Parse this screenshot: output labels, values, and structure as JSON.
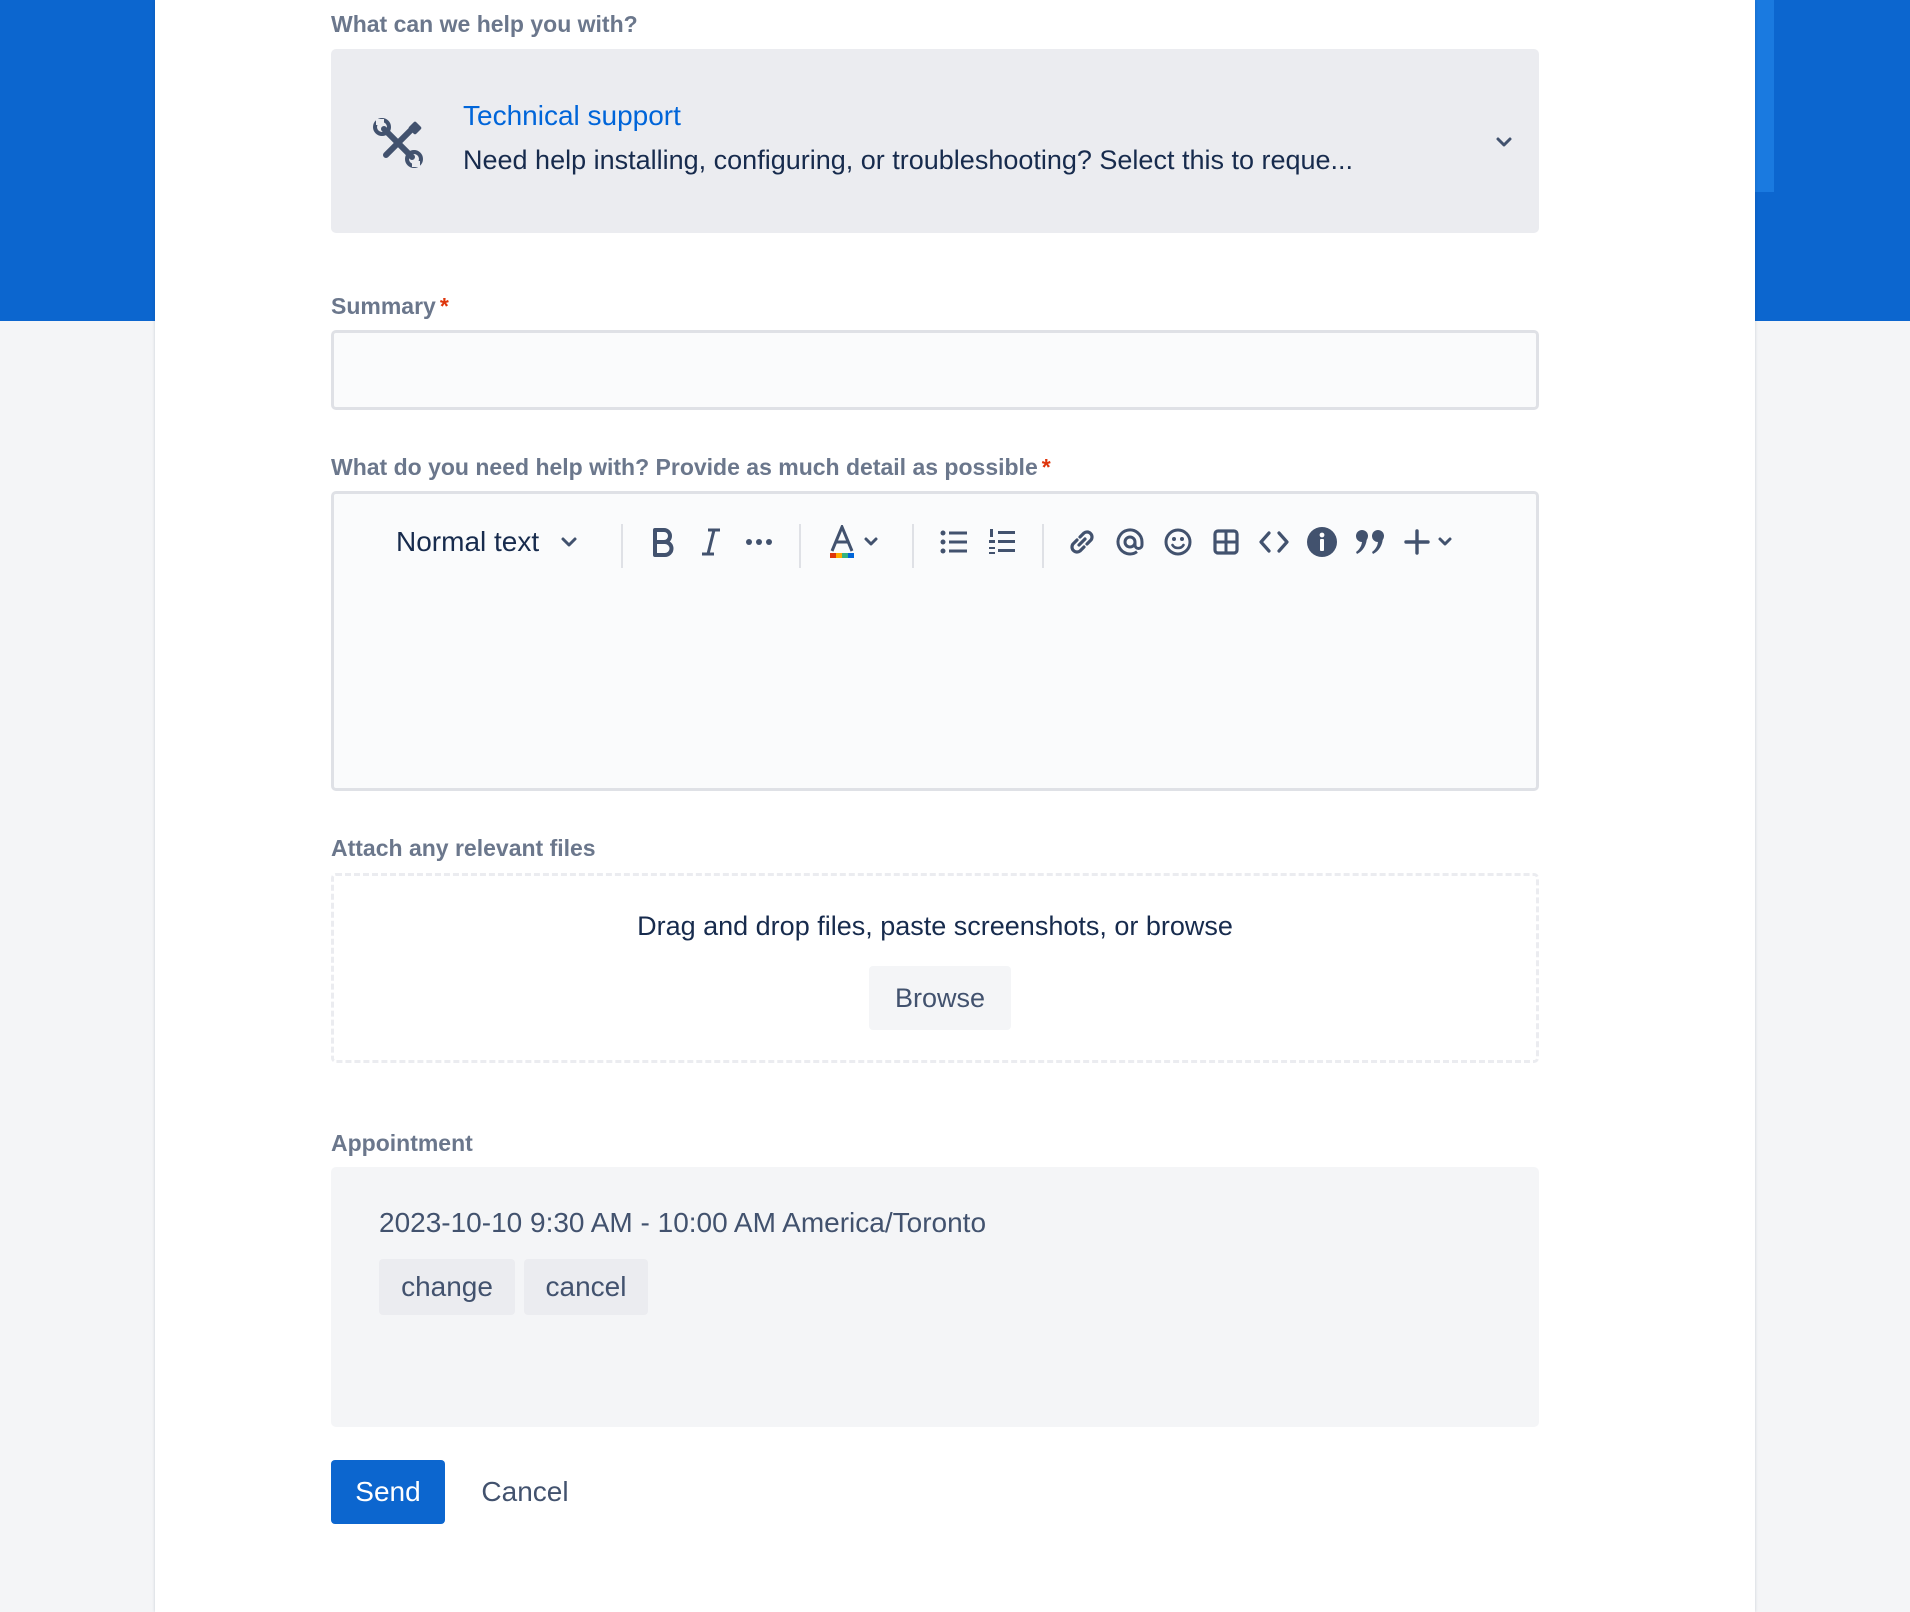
{
  "request_type": {
    "label": "What can we help you with?",
    "icon": "tools-icon",
    "title": "Technical support",
    "description": "Need help installing, configuring, or troubleshooting? Select this to reque..."
  },
  "summary": {
    "label": "Summary",
    "required_mark": "*",
    "value": ""
  },
  "description_field": {
    "label": "What do you need help with? Provide as much detail as possible",
    "required_mark": "*",
    "toolbar": {
      "text_style": "Normal text",
      "icons": [
        "bold-icon",
        "italic-icon",
        "more-formatting-icon",
        "text-color-icon",
        "bullet-list-icon",
        "numbered-list-icon",
        "link-icon",
        "mention-icon",
        "emoji-icon",
        "table-icon",
        "code-icon",
        "info-panel-icon",
        "quote-icon",
        "insert-icon"
      ]
    }
  },
  "attachments": {
    "label": "Attach any relevant files",
    "prompt": "Drag and drop files, paste screenshots, or browse",
    "browse_label": "Browse"
  },
  "appointment": {
    "label": "Appointment",
    "value": "2023-10-10 9:30 AM - 10:00 AM America/Toronto",
    "change_label": "change",
    "cancel_label": "cancel"
  },
  "actions": {
    "send_label": "Send",
    "cancel_label": "Cancel"
  },
  "colors": {
    "brand": "#0c66cf",
    "link": "#0065d9",
    "required": "#de350b"
  }
}
